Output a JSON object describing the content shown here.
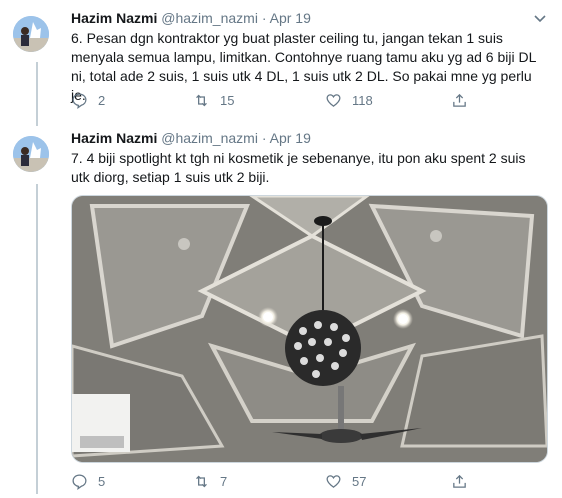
{
  "tweets": [
    {
      "name": "Hazim Nazmi",
      "handle": "@hazim_nazmi",
      "separator": "·",
      "date": "Apr 19",
      "text": "6. Pesan dgn kontraktor yg buat plaster ceiling tu, jangan tekan 1 suis\nmenyala semua lampu, limitkan. Contohnye ruang tamu aku yg ad 6 biji DL\nni, total ade 2 suis, 1 suis utk 4 DL, 1 suis utk 2 DL. So pakai mne yg perlu je.",
      "replies": "2",
      "retweets": "15",
      "likes": "118"
    },
    {
      "name": "Hazim Nazmi",
      "handle": "@hazim_nazmi",
      "separator": "·",
      "date": "Apr 19",
      "text": "7. 4 biji spotlight kt tgh ni kosmetik je sebenanye, itu pon aku spent 2 suis\nutk diorg, setiap 1 suis utk 2 biji.",
      "replies": "5",
      "retweets": "7",
      "likes": "57"
    }
  ],
  "icons": {
    "reply": "reply-icon",
    "retweet": "retweet-icon",
    "like": "heart-icon",
    "share": "share-icon",
    "more": "chevron-down-icon"
  },
  "colors": {
    "text": "#14171a",
    "muted": "#657786",
    "thread_line": "#c4cfd6"
  }
}
